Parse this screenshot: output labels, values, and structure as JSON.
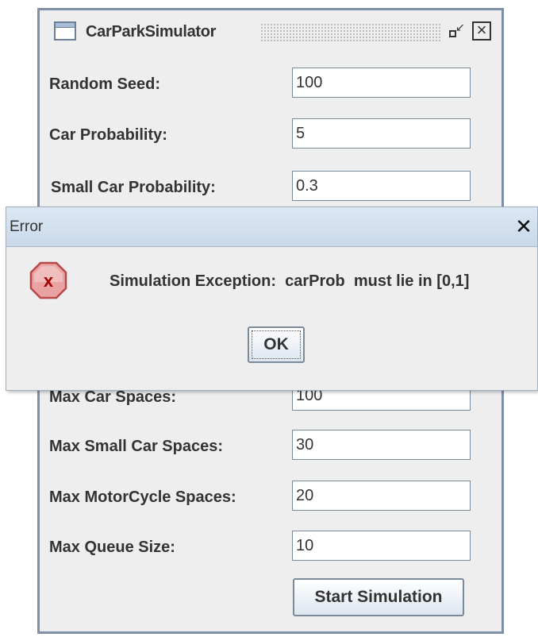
{
  "window": {
    "title": "CarParkSimulator",
    "icons": {
      "app": "window-icon",
      "restore": "restore-icon",
      "close": "close-icon"
    },
    "close_glyph": "☒"
  },
  "form": {
    "fields": [
      {
        "label": "Random Seed:",
        "value": "100"
      },
      {
        "label": "Car Probability:",
        "value": "5"
      },
      {
        "label": "Small Car Probability:",
        "value": "0.3"
      },
      {
        "label": "Max Car Spaces:",
        "value": "100"
      },
      {
        "label": "Max Small Car Spaces:",
        "value": "30"
      },
      {
        "label": "Max MotorCycle Spaces:",
        "value": "20"
      },
      {
        "label": "Max Queue Size:",
        "value": "10"
      }
    ],
    "start_button_label": "Start Simulation"
  },
  "dialog": {
    "title": "Error",
    "close_glyph": "✕",
    "icon": "error-icon",
    "message": "Simulation Exception:  carProb  must lie in [0,1]",
    "ok_label": "OK",
    "colors": {
      "icon_fill": "#e8a0a0",
      "icon_x": "#a80000"
    }
  }
}
